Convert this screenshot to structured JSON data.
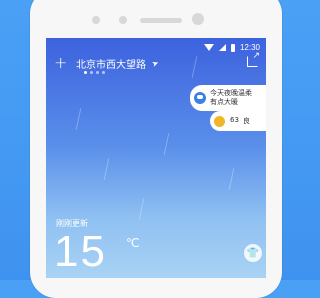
{
  "status_bar": {
    "time": "12:30"
  },
  "header": {
    "add_label": "+",
    "location": "北京市西大望路",
    "location_icon": "location-arrow-icon",
    "share_icon": "share-icon"
  },
  "pager": {
    "count": 4,
    "active_index": 0
  },
  "cards": {
    "forecast": {
      "line1": "今天夜晚温柔",
      "line2": "有点大暖",
      "icon": "cloud-rain-icon"
    },
    "aqi": {
      "value": "63",
      "level": "良",
      "icon": "aqi-badge-icon"
    }
  },
  "weather": {
    "updated_label": "刚刚更新",
    "temperature": "15",
    "unit": "℃"
  },
  "colors": {
    "background": "#4aa0f5",
    "screen_top": "#3d62de",
    "screen_bottom": "#a9d3f4",
    "aqi_accent": "#f1b628",
    "forecast_accent": "#3b7fe8"
  }
}
